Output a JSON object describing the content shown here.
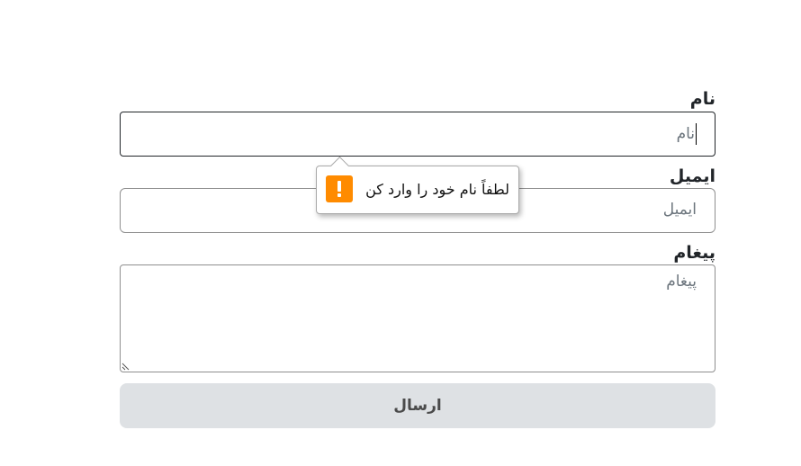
{
  "form": {
    "name": {
      "label": "نام",
      "placeholder": "نام"
    },
    "email": {
      "label": "ایمیل",
      "placeholder": "ایمیل"
    },
    "message": {
      "label": "پیغام",
      "placeholder": "پیغام"
    },
    "submit_label": "ارسال"
  },
  "validation": {
    "message": "لطفاً نام خود را وارد کن",
    "icon": "warning-icon",
    "icon_color": "#ff8b00"
  }
}
